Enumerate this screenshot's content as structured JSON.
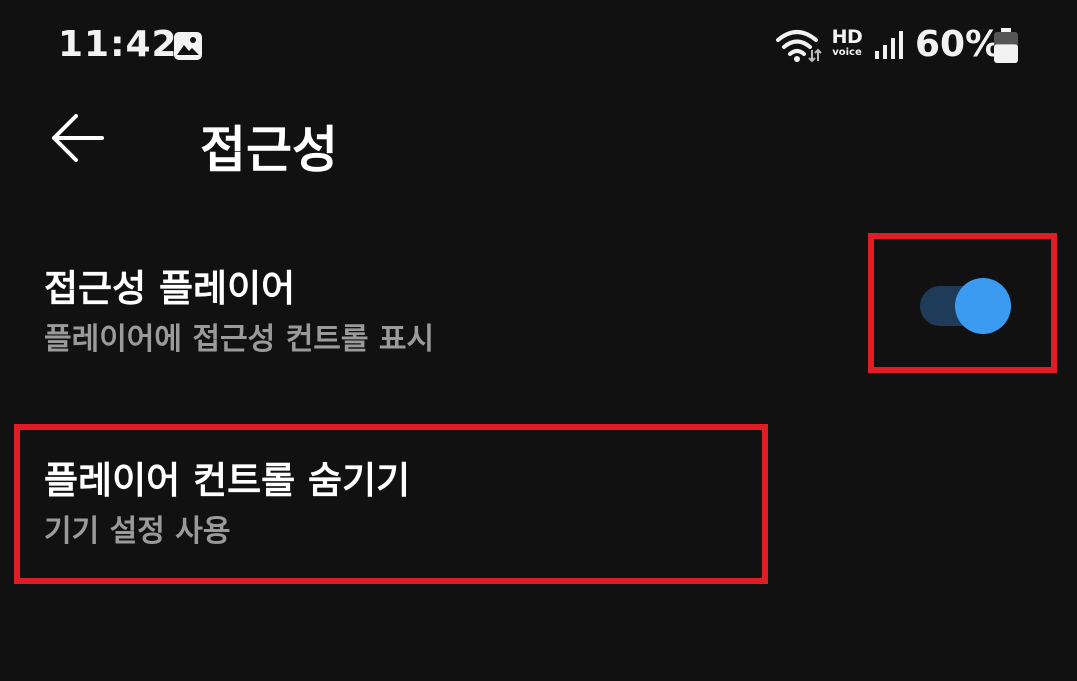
{
  "status_bar": {
    "time": "11:42",
    "gallery_icon": "image-notification-icon",
    "wifi_icon": "wifi-icon",
    "hd_voice": {
      "hd": "HD",
      "voice": "voice"
    },
    "signal_icon": "cell-signal-icon",
    "battery_percent": "60%",
    "battery_icon": "battery-icon",
    "battery_level": 0.6
  },
  "header": {
    "back_icon": "arrow-left-icon",
    "title": "접근성"
  },
  "settings": [
    {
      "title": "접근성 플레이어",
      "summary": "플레이어에 접근성 컨트롤 표시",
      "toggle_on": true
    },
    {
      "title": "플레이어 컨트롤 숨기기",
      "summary": "기기 설정 사용"
    }
  ],
  "colors": {
    "background": "#111111",
    "toggle_track": "#1f3b5a",
    "toggle_thumb": "#3a9bf0",
    "highlight": "#e01c26",
    "summary_text": "#9a9a9a"
  }
}
